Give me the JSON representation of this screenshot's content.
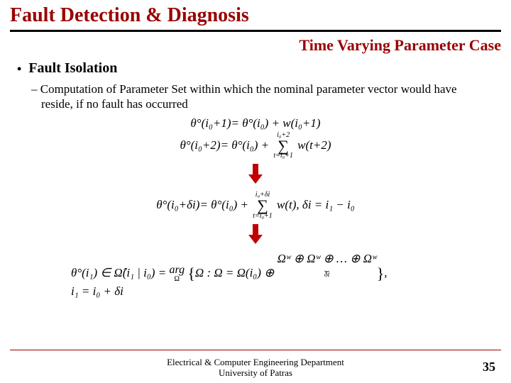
{
  "title": "Fault Detection & Diagnosis",
  "subtitle": "Time Varying Parameter Case",
  "bullet1": "Fault Isolation",
  "bullet2": "– Computation of Parameter Set within which the nominal parameter vector would have reside, if no fault has occurred",
  "eq1_lhs": "θ°(i₀+1)",
  "eq1_rhs": "= θ°(i₀) + w(i₀+1)",
  "eq2_lhs": "θ°(i₀+2)",
  "eq2_rhs_a": "= θ°(i₀) +",
  "eq2_sum_top": "i₀+2",
  "eq2_sum_bot": "t=i₀+1",
  "eq2_rhs_b": "w(t+2)",
  "eq3_lhs": "θ°(i₀+δi)",
  "eq3_rhs_a": "= θ°(i₀) +",
  "eq3_sum_top": "i₀+δi",
  "eq3_sum_bot": "t=i₀+1",
  "eq3_rhs_b": "w(t), δi = i₁ − i₀",
  "eq4_lhs": "θ°(i₁) ∈ Ω̂(i₁ | i₀) =",
  "eq4_arg": "arg",
  "eq4_arg_sub": "Ω",
  "eq4_set_a": "Ω : Ω = Ω(i₀) ⊕",
  "eq4_set_b": "Ωʷ ⊕ Ωʷ ⊕ … ⊕ Ωʷ",
  "eq4_brace_label": "δi",
  "eq4_comma": ",",
  "eq5": "i₁ = i₀ + δi",
  "footer_line1": "Electrical & Computer Engineering Department",
  "footer_line2": "University of Patras",
  "page_number": "35"
}
